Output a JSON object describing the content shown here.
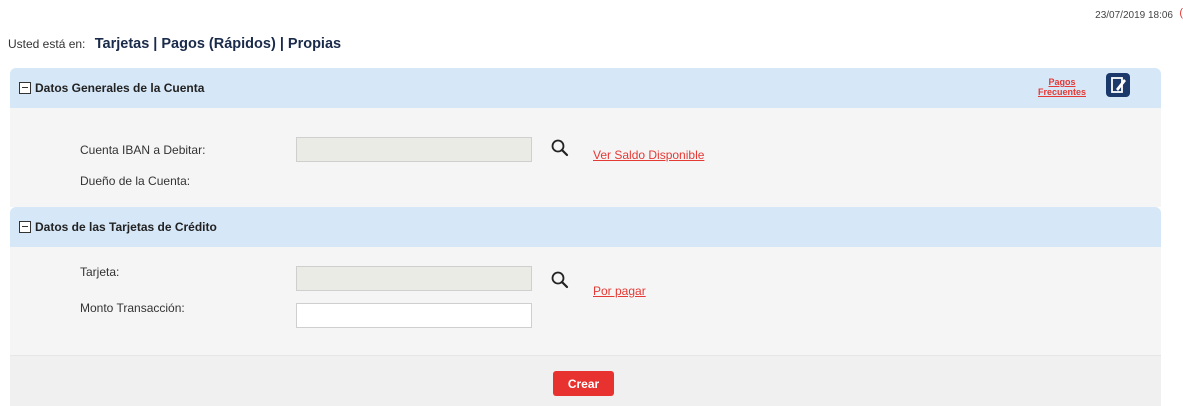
{
  "timestamp": "23/07/2019 18:06",
  "breadcrumb": {
    "prefix": "Usted está en:",
    "path": "Tarjetas | Pagos (Rápidos) | Propias"
  },
  "section1": {
    "title": "Datos Generales de la Cuenta",
    "pagos_frecuentes_line1": "Pagos",
    "pagos_frecuentes_line2": "Frecuentes",
    "cuenta_label": "Cuenta IBAN a Debitar:",
    "cuenta_value": "",
    "ver_saldo_link": "Ver Saldo Disponible",
    "dueno_label": "Dueño de la Cuenta:"
  },
  "section2": {
    "title": "Datos de las Tarjetas de Crédito",
    "tarjeta_label": "Tarjeta:",
    "tarjeta_value": "",
    "por_pagar_link": "Por pagar",
    "monto_label": "Monto Transacción:",
    "monto_value": ""
  },
  "footer": {
    "crear_label": "Crear"
  },
  "colors": {
    "accent_red": "#e8322f",
    "header_blue": "#d6e7f7",
    "icon_navy": "#1b3a6b"
  },
  "icons": {
    "search": "search-icon",
    "edit": "edit-document-icon",
    "collapse": "collapse-minus-icon"
  }
}
